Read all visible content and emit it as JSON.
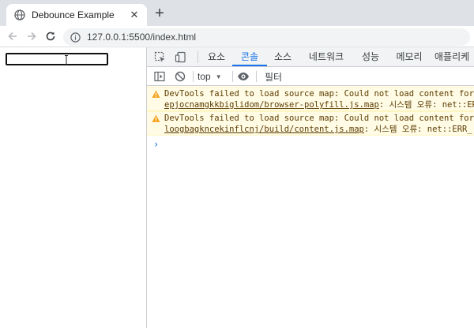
{
  "browser": {
    "tab_title": "Debounce Example",
    "tab_close": "✕",
    "new_tab": "+",
    "url": "127.0.0.1:5500/index.html"
  },
  "page": {
    "input_value": ""
  },
  "devtools": {
    "panel_tabs": [
      "요소",
      "콘솔",
      "소스",
      "네트워크",
      "성능",
      "메모리",
      "애플리케"
    ],
    "active_tab": "콘솔",
    "context": "top",
    "filter_placeholder": "필터",
    "messages": [
      {
        "text": "DevTools failed to load source map: Could not load content for ",
        "link_tail": "c",
        "file": "epjocnamgkkbiglidom/browser-polyfill.js.map",
        "suffix": ": 시스템 오류: net::ER"
      },
      {
        "text": "DevTools failed to load source map: Could not load content for ",
        "link_tail": "c",
        "file": "loogbagkncekinflcnj/build/content.js.map",
        "suffix": ": 시스템 오류: net::ERR_"
      }
    ],
    "prompt": "›"
  },
  "colors": {
    "accent": "#1a73e8",
    "warning_bg": "#fffbe5",
    "warning_text": "#5c3c00",
    "warning_icon": "#f5a623"
  },
  "icons": {
    "tab_favicon": "globe-icon",
    "back": "arrow-left-icon",
    "forward": "arrow-right-icon",
    "reload": "reload-icon",
    "site_info": "info-icon",
    "inspect": "inspect-element-icon",
    "device": "device-toggle-icon",
    "sidebar": "console-sidebar-icon",
    "clear": "clear-console-icon",
    "eye": "live-expression-icon",
    "warning": "warning-icon"
  }
}
